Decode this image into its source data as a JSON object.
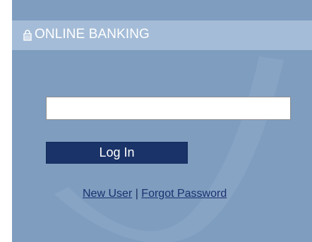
{
  "header": {
    "icon": "lock-icon",
    "title": "ONLINE BANKING"
  },
  "login": {
    "username_value": "",
    "button_label": "Log In"
  },
  "links": {
    "new_user": "New User",
    "separator": "|",
    "forgot_password": "Forgot Password"
  },
  "colors": {
    "panel_bg": "#7e9dbf",
    "header_bg": "#a4bcd7",
    "button_bg": "#1a3368",
    "link": "#1a3170"
  }
}
